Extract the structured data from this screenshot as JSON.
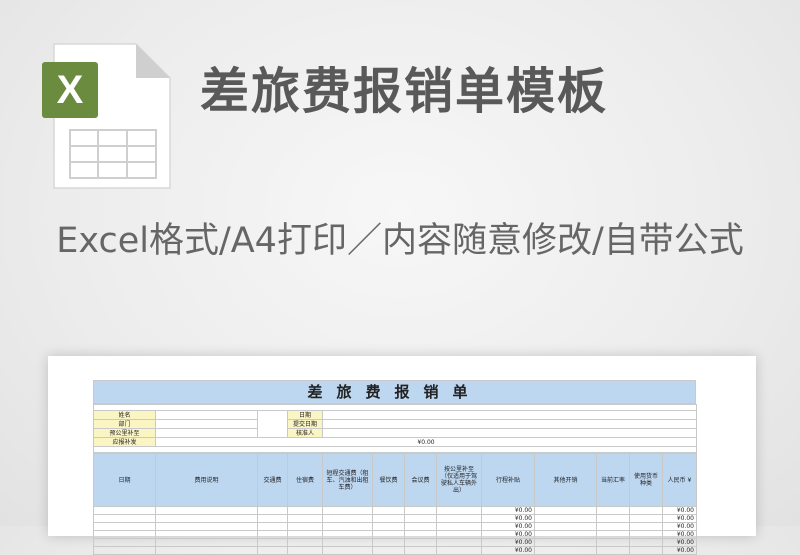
{
  "header": {
    "title": "差旅费报销单模板",
    "subtitle": "Excel格式/A4打印／内容随意修改/自带公式"
  },
  "file_icon": {
    "badge_letter": "X",
    "badge_color": "#6b8c3e",
    "icon": "excel-file-icon"
  },
  "sheet": {
    "title": "差旅费报销单",
    "info_left": [
      "姓名",
      "部门",
      "预公里补至",
      "应报补发"
    ],
    "info_right": [
      "日期",
      "提交日期",
      "核准人"
    ],
    "total_amount": "¥0.00",
    "columns": [
      "日期",
      "费用说明",
      "交通费",
      "住宿费",
      "短程交通费（租车、汽油和出租车费）",
      "餐饮费",
      "会议费",
      "按公里补至（仅适用于驾驶私人车辆外出）",
      "行程补贴",
      "其他开销",
      "当前汇率",
      "使用货币种类",
      "人民币 ¥"
    ],
    "row_amount": "¥0.00"
  }
}
